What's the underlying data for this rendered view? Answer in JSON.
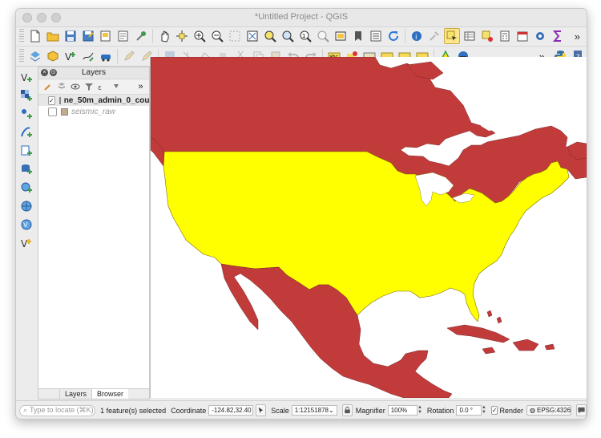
{
  "window": {
    "title": "*Untitled Project - QGIS"
  },
  "toolbar": {
    "more_label": "»"
  },
  "toolbar2": {
    "more_label": "»"
  },
  "layers_panel": {
    "title": "Layers",
    "more_label": "»",
    "layers": [
      {
        "name": "ne_50m_admin_0_cou...",
        "checked": "✓",
        "color": "#b5474a"
      },
      {
        "name": "seismic_raw",
        "checked": "",
        "color": "#c2ad8f"
      }
    ],
    "tabs": [
      {
        "label": "Layers"
      },
      {
        "label": "Browser"
      }
    ]
  },
  "map": {
    "land_color": "#c23b3b",
    "selected_color": "#ffff00",
    "water_color": "#ffffff"
  },
  "statusbar": {
    "locate_placeholder": "Type to locate (⌘K)",
    "selection_text": "1 feature(s) selected",
    "coordinate_label": "Coordinate",
    "coordinate_value": "-124.82,32.40",
    "scale_label": "Scale",
    "scale_value": "1:12151878",
    "magnifier_label": "Magnifier",
    "magnifier_value": "100%",
    "rotation_label": "Rotation",
    "rotation_value": "0.0 °",
    "render_label": "Render",
    "render_checked": "✓",
    "crs_label": "EPSG:4326"
  }
}
